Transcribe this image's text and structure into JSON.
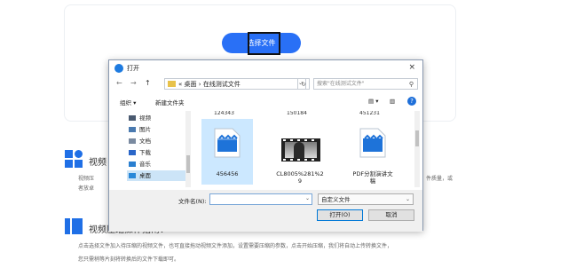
{
  "upload": {
    "select_label": "选择文件"
  },
  "section1": {
    "title": "视频",
    "text_line1": "视频压",
    "text_line1_tail": "件质量，或",
    "text_line2": "者放卓"
  },
  "section2": {
    "title": "视频压缩操作指南：",
    "text_line1": "点击选择文件加入待压缩的视频文件，也可直接拖动视频文件添加，设置需要压缩的参数，点击开始压缩，我们将自动上传转换文件，",
    "text_line2": "您只需稍等片刻将转换后的文件下载即可。"
  },
  "dialog": {
    "title": "打开",
    "close": "×",
    "nav": {
      "back": "←",
      "forward": "→",
      "up": "↑",
      "path_prefix": "«",
      "path1": "桌面",
      "sep": "›",
      "path2": "在线测试文件",
      "refresh": "↻",
      "search_placeholder": "搜索\"在线测试文件\"",
      "search_icon": "⚲"
    },
    "toolbar": {
      "organize": "组织 ▾",
      "new_folder": "新建文件夹",
      "view_icon": "▤ ▾",
      "pane_icon": "▥",
      "help": "?"
    },
    "sidebar": [
      {
        "label": "视频",
        "icon": "video-icon",
        "color": "#4a5a70"
      },
      {
        "label": "图片",
        "icon": "picture-icon",
        "color": "#4a7ab0"
      },
      {
        "label": "文档",
        "icon": "document-icon",
        "color": "#7a8aa0"
      },
      {
        "label": "下载",
        "icon": "download-icon",
        "color": "#2a66c8"
      },
      {
        "label": "音乐",
        "icon": "music-icon",
        "color": "#2a7fd0"
      },
      {
        "label": "桌面",
        "icon": "desktop-icon",
        "color": "#2a88d8"
      }
    ],
    "files_cut": [
      "124343",
      "150184",
      "451231"
    ],
    "files": [
      {
        "name": "456456",
        "selected": true
      },
      {
        "name_line1": "CL8005%281%2",
        "name_line2": "9"
      },
      {
        "name_line1": "PDF分割演讲文",
        "name_line2": "稿"
      }
    ],
    "footer": {
      "filename_label": "文件名(N):",
      "filetype": "自定义文件",
      "open": "打开(O)",
      "cancel": "取消"
    }
  }
}
